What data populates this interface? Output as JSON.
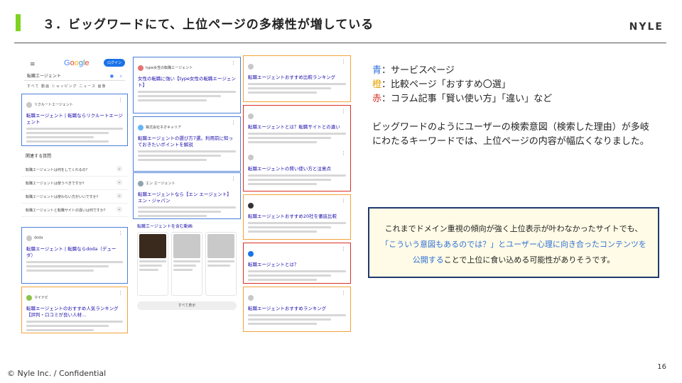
{
  "header": {
    "title": "３．ビッグワードにて、上位ページの多様性が増している",
    "logo": "NYLE"
  },
  "legend": {
    "blue_key": "青",
    "blue_text": "：サービスページ",
    "orange_key": "橙",
    "orange_text": "：比較ページ「おすすめ〇選」",
    "red_key": "赤",
    "red_text": "：コラム記事「賢い使い方」「違い」など"
  },
  "paragraph": "ビッグワードのようにユーザーの検索意図（検索した理由）が多岐にわたるキーワードでは、上位ページの内容が幅広くなりました。",
  "callout": {
    "before": "これまでドメイン重視の傾向が強く上位表示が叶わなかったサイトでも、",
    "highlight": "「こういう意図もあるのでは？」とユーザー心理に向き合ったコンテンツを公開する",
    "after": "ことで上位に食い込める可能性がありそうです。"
  },
  "footer": {
    "copyright": "© Nyle Inc. / Confidential",
    "page_number": "16"
  },
  "colors": {
    "accent": "#7ed321",
    "service_blue": "#4a7fd8",
    "compare_orange": "#f2a33a",
    "column_red": "#d93025",
    "callout_border": "#1f3a6e",
    "callout_bg": "#fffbe6"
  },
  "screenshot": {
    "google": {
      "logo_text": "Google",
      "login_label": "ログイン",
      "search_query": "転職エージェント",
      "tabs": "すべて  動画  ショッピング  ニュース  画像"
    },
    "col1": {
      "card1_site": "リクルートエージェント",
      "card1_title": "転職エージェント | 転職ならリクルートエージェント",
      "paa_title": "関連する質問",
      "paa_items": [
        "転職エージェントは何をしてくれるの？",
        "転職エージェントは使うべきですか？",
        "転職エージェントは使わない方がいいですか？",
        "転職エージェントと転職サイトの違いは何ですか？"
      ],
      "card2_site": "doda",
      "card2_title": "転職エージェント | 転職ならdoda（デューダ）",
      "card3_site": "マイナビ",
      "card3_title": "転職エージェントのおすすめ人気ランキング【評判・口コミが良い人材..."
    },
    "col2": {
      "card1_site": "type女性の転職エージェント",
      "card1_title": "女性の転職に強い【type女性の転職エージェント】",
      "card2_site": "株式会社ネオキャリア",
      "card2_title": "転職エージェントの選び方7選。利用前に知っておきたいポイントを解説",
      "card3_site": "エン エージェント",
      "card3_title": "転職エージェントなら【エン エージェント】エン・ジャパン",
      "video_title": "転職エージェントを含む動画",
      "more_label": "すべて表示"
    },
    "col3": {
      "card1_title": "転職エージェントおすすめ比較ランキング",
      "card2_title": "転職エージェントとは？転職サイトとの違い",
      "card3_title": "転職エージェントの賢い使い方と注意点",
      "card4_title": "転職エージェントおすすめ20社を徹底比較",
      "card5_title": "転職エージェントとは？",
      "card6_title": "転職エージェントおすすめランキング"
    }
  }
}
